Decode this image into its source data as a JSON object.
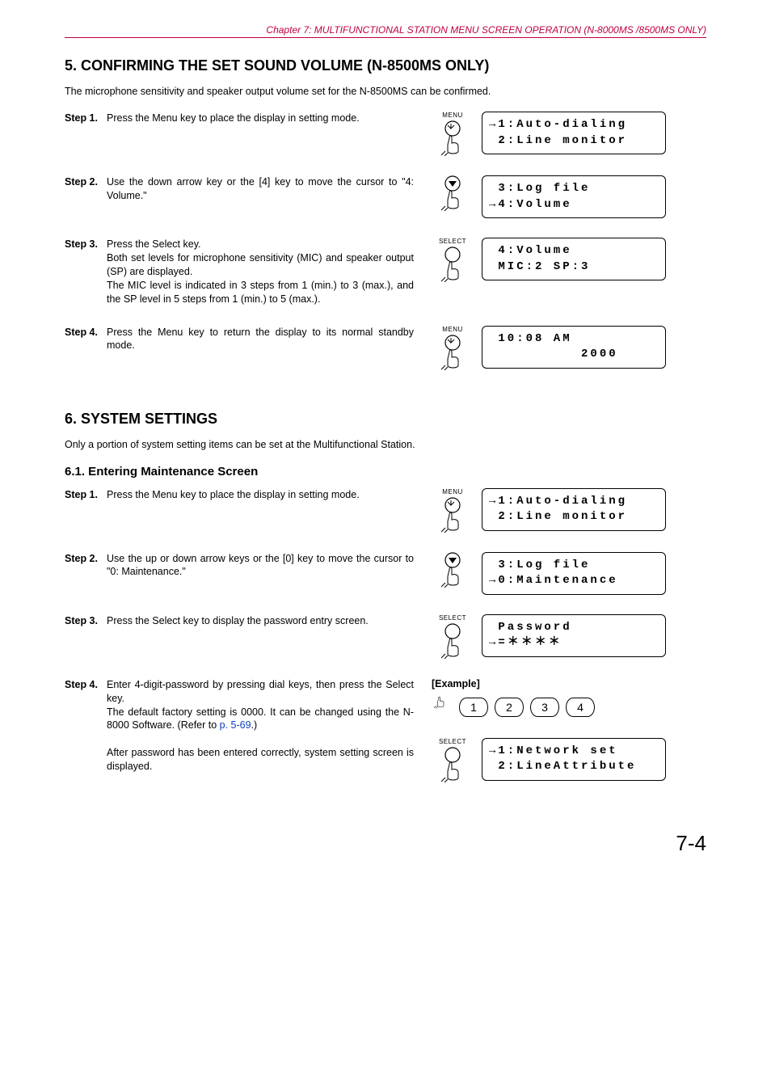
{
  "header": {
    "chapter": "Chapter 7:  MULTIFUNCTIONAL STATION MENU SCREEN OPERATION (N-8000MS /8500MS ONLY)"
  },
  "section5": {
    "title": "5. CONFIRMING THE SET SOUND VOLUME (N-8500MS ONLY)",
    "intro": "The microphone sensitivity and speaker output volume set for the N-8500MS can be confirmed.",
    "steps": [
      {
        "label": "Step 1.",
        "text": "Press the Menu key to place the display in setting mode.",
        "key": "MENU",
        "icon": "menu-press",
        "lcd": [
          "→1:Auto-dialing",
          " 2:Line monitor"
        ]
      },
      {
        "label": "Step 2.",
        "text": "Use the down arrow key or the [4] key to move the cursor to \"4: Volume.\"",
        "key": "",
        "icon": "down-press",
        "lcd": [
          " 3:Log file",
          "→4:Volume"
        ]
      },
      {
        "label": "Step 3.",
        "text": "Press the Select key.\nBoth set levels for microphone sensitivity (MIC) and speaker output (SP) are displayed.\nThe MIC level is indicated in 3 steps from 1 (min.) to 3 (max.), and the SP level in 5 steps from 1 (min.) to 5 (max.).",
        "key": "SELECT",
        "icon": "select-press",
        "lcd": [
          " 4:Volume",
          " MIC:2 SP:3"
        ]
      },
      {
        "label": "Step 4.",
        "text": "Press the Menu key to return the display to its normal standby mode.",
        "key": "MENU",
        "icon": "menu-press",
        "lcd": [
          " 10:08 AM",
          "          2000"
        ]
      }
    ]
  },
  "section6": {
    "title": "6. SYSTEM SETTINGS",
    "intro": "Only a portion of system setting items can be set at the Multifunctional Station.",
    "sub1": {
      "title": "6.1. Entering Maintenance Screen",
      "steps": [
        {
          "label": "Step 1.",
          "text": "Press the Menu key to place the display in setting mode.",
          "key": "MENU",
          "icon": "menu-press",
          "lcd": [
            "→1:Auto-dialing",
            " 2:Line monitor"
          ]
        },
        {
          "label": "Step 2.",
          "text": "Use the up or down arrow keys or the [0] key to move the cursor to \"0: Maintenance.\"",
          "key": "",
          "icon": "down-press",
          "lcd": [
            " 3:Log file",
            "→0:Maintenance"
          ]
        },
        {
          "label": "Step 3.",
          "text": "Press the Select key to display the password entry screen.",
          "key": "SELECT",
          "icon": "select-press",
          "lcd": [
            " Password",
            "→=＊＊＊＊"
          ]
        },
        {
          "label": "Step 4.",
          "text_part1": "Enter 4-digit-password by pressing dial keys, then press the Select key.\nThe default factory setting is 0000. It can be changed using the N-8000 Software. (Refer to ",
          "link": "p. 5-69",
          "text_part2": ".)\n\nAfter password has been entered correctly, system setting screen is displayed.",
          "example_label": "[Example]",
          "dial": [
            "1",
            "2",
            "3",
            "4"
          ],
          "key2": "SELECT",
          "icon2": "select-press",
          "lcd2": [
            "→1:Network set",
            " 2:LineAttribute"
          ]
        }
      ]
    }
  },
  "page_number": "7-4"
}
